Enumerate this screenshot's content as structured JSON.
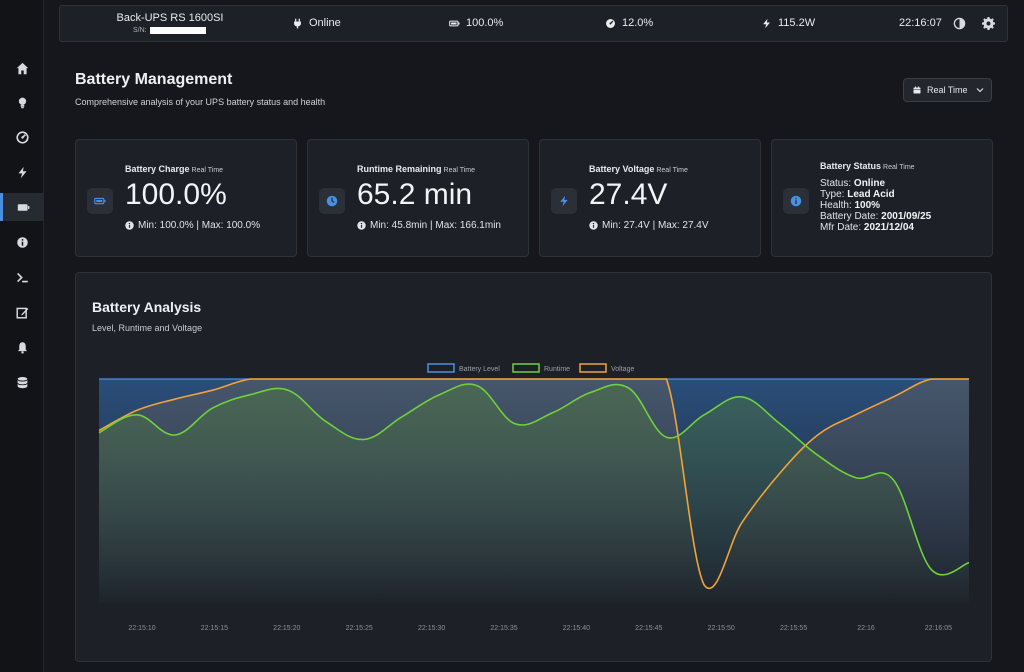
{
  "device": {
    "model": "Back-UPS RS 1600SI",
    "serial_label": "S/N:"
  },
  "topbar": {
    "status": "Online",
    "battery": "100.0%",
    "load": "12.0%",
    "power": "115.2W",
    "clock": "22:16:07",
    "icons": [
      "plug-icon",
      "battery-icon",
      "gauge-icon",
      "bolt-icon",
      "contrast-icon",
      "gear-icon"
    ]
  },
  "sidebar": {
    "items": [
      {
        "icon": "home-icon"
      },
      {
        "icon": "lightbulb-icon"
      },
      {
        "icon": "gauge-icon"
      },
      {
        "icon": "bolt-icon"
      },
      {
        "icon": "battery-icon",
        "active": true
      },
      {
        "icon": "info-circle-icon"
      },
      {
        "icon": "terminal-icon"
      },
      {
        "icon": "edit-icon"
      },
      {
        "icon": "bell-icon"
      },
      {
        "icon": "database-icon"
      }
    ]
  },
  "page": {
    "title": "Battery Management",
    "subtitle": "Comprehensive analysis of your UPS battery status and health",
    "range_label": "Real Time"
  },
  "cards": {
    "charge": {
      "title": "Battery Charge",
      "tag": "Real Time",
      "value": "100.0%",
      "minmax": "Min: 100.0% | Max: 100.0%"
    },
    "runtime": {
      "title": "Runtime Remaining",
      "tag": "Real Time",
      "value": "65.2 min",
      "minmax": "Min: 45.8min | Max: 166.1min"
    },
    "voltage": {
      "title": "Battery Voltage",
      "tag": "Real Time",
      "value": "27.4V",
      "minmax": "Min: 27.4V | Max: 27.4V"
    },
    "status": {
      "title": "Battery Status",
      "tag": "Real Time",
      "status_label": "Status:",
      "status_value": "Online",
      "type_label": "Type:",
      "type_value": "Lead Acid",
      "health_label": "Health:",
      "health_value": "100%",
      "battery_date_label": "Battery Date:",
      "battery_date_value": "2001/09/25",
      "mfr_date_label": "Mfr Date:",
      "mfr_date_value": "2021/12/04"
    }
  },
  "chart": {
    "title": "Battery Analysis",
    "subtitle": "Level, Runtime and Voltage"
  },
  "colors": {
    "battery": "#4a90e2",
    "runtime": "#6fd13a",
    "voltage": "#f2a33a",
    "accent": "#4a90e2"
  },
  "chart_data": {
    "type": "area",
    "legend": [
      "Battery Level",
      "Runtime",
      "Voltage"
    ],
    "legend_position": "top",
    "x_ticks": [
      "22:15:10",
      "22:15:15",
      "22:15:20",
      "22:15:25",
      "22:15:30",
      "22:15:35",
      "22:15:40",
      "22:15:45",
      "22:15:50",
      "22:15:55",
      "22:16",
      "22:16:05"
    ],
    "grid": false,
    "ylim": [
      0,
      100
    ],
    "series": [
      {
        "name": "Battery Level",
        "points": [
          [
            0,
            100
          ],
          [
            1,
            100
          ],
          [
            2,
            100
          ],
          [
            3,
            100
          ],
          [
            4,
            100
          ],
          [
            5,
            100
          ],
          [
            6,
            100
          ],
          [
            7,
            100
          ],
          [
            8,
            100
          ],
          [
            9,
            100
          ],
          [
            10,
            100
          ],
          [
            11,
            100
          ],
          [
            12,
            100
          ],
          [
            13,
            100
          ],
          [
            14,
            100
          ],
          [
            15,
            100
          ],
          [
            16,
            100
          ],
          [
            17,
            100
          ],
          [
            18,
            100
          ],
          [
            19,
            100
          ],
          [
            20,
            100
          ],
          [
            21,
            100
          ],
          [
            22,
            100
          ],
          [
            23,
            100
          ]
        ]
      },
      {
        "name": "Runtime",
        "points": [
          [
            0,
            76
          ],
          [
            1,
            84
          ],
          [
            2,
            75
          ],
          [
            3,
            87
          ],
          [
            4,
            93
          ],
          [
            5,
            95
          ],
          [
            6,
            81
          ],
          [
            7,
            73
          ],
          [
            8,
            83
          ],
          [
            9,
            93
          ],
          [
            10,
            97
          ],
          [
            11,
            80
          ],
          [
            12,
            85
          ],
          [
            13,
            94
          ],
          [
            14,
            96
          ],
          [
            15,
            74
          ],
          [
            16,
            84
          ],
          [
            17,
            92
          ],
          [
            18,
            80
          ],
          [
            19,
            66
          ],
          [
            20,
            56
          ],
          [
            21,
            55
          ],
          [
            22,
            15
          ],
          [
            23,
            18
          ]
        ]
      },
      {
        "name": "Voltage",
        "points": [
          [
            0,
            77
          ],
          [
            1,
            86
          ],
          [
            2,
            91
          ],
          [
            3,
            95
          ],
          [
            4,
            100
          ],
          [
            5,
            100
          ],
          [
            6,
            100
          ],
          [
            7,
            100
          ],
          [
            8,
            100
          ],
          [
            9,
            100
          ],
          [
            10,
            100
          ],
          [
            11,
            100
          ],
          [
            12,
            100
          ],
          [
            13,
            100
          ],
          [
            14,
            100
          ],
          [
            15,
            100
          ],
          [
            16,
            8
          ],
          [
            17,
            36
          ],
          [
            18,
            58
          ],
          [
            19,
            75
          ],
          [
            20,
            84
          ],
          [
            21,
            92
          ],
          [
            22,
            100
          ],
          [
            23,
            100
          ]
        ]
      }
    ]
  }
}
